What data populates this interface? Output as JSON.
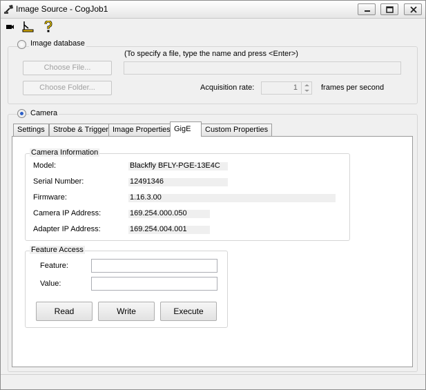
{
  "window": {
    "title": "Image Source - CogJob1"
  },
  "toolbar": {
    "icons": [
      "camera-icon",
      "acquire-icon",
      "help-icon"
    ]
  },
  "image_database": {
    "radio_label": "Image database",
    "hint": "(To specify a file, type the name and press <Enter>)",
    "choose_file_label": "Choose File...",
    "choose_folder_label": "Choose Folder...",
    "file_path_value": "",
    "acquisition_rate_label": "Acquisition rate:",
    "acquisition_rate_value": "1",
    "frames_per_second_label": "frames per second",
    "selected": false
  },
  "camera": {
    "radio_label": "Camera",
    "selected": true
  },
  "tabs": [
    {
      "label": "Settings",
      "active": false
    },
    {
      "label": "Strobe & Trigger",
      "active": false
    },
    {
      "label": "Image Properties",
      "active": false
    },
    {
      "label": "GigE",
      "active": true
    },
    {
      "label": "Custom Properties",
      "active": false
    }
  ],
  "camera_information": {
    "title": "Camera Information",
    "rows": [
      {
        "label": "Model:",
        "value": "Blackfly BFLY-PGE-13E4C"
      },
      {
        "label": "Serial Number:",
        "value": "12491346"
      },
      {
        "label": "Firmware:",
        "value": "1.16.3.00"
      },
      {
        "label": "Camera IP Address:",
        "value": "169.254.000.050"
      },
      {
        "label": "Adapter IP Address:",
        "value": "169.254.004.001"
      }
    ]
  },
  "feature_access": {
    "title": "Feature Access",
    "feature_label": "Feature:",
    "feature_value": "",
    "value_label": "Value:",
    "value_value": "",
    "read_label": "Read",
    "write_label": "Write",
    "execute_label": "Execute"
  }
}
